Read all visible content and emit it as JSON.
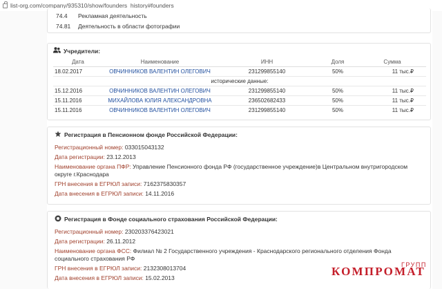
{
  "browser": {
    "url": "list-org.com/company/935310/show/founders_history#founders"
  },
  "okved": [
    {
      "code": "74.4",
      "name": "Рекламная деятельность"
    },
    {
      "code": "74.81",
      "name": "Деятельность в области фотографии"
    }
  ],
  "founders": {
    "title": "Учредители:",
    "columns": [
      "Дата",
      "Наименование",
      "ИНН",
      "Доля",
      "Сумма"
    ],
    "current": {
      "date": "18.02.2017",
      "name": "ОВЧИННИКОВ ВАЛЕНТИН ОЛЕГОВИЧ",
      "inn": "231299855140",
      "share": "50%",
      "sum": "11 тыс.₽"
    },
    "history_label": "исторические данные:",
    "history": [
      {
        "date": "15.12.2016",
        "name": "ОВЧИННИКОВ ВАЛЕНТИН ОЛЕГОВИЧ",
        "inn": "231299855140",
        "share": "50%",
        "sum": "11 тыс.₽"
      },
      {
        "date": "15.11.2016",
        "name": "МИХАЙЛОВА ЮЛИЯ АЛЕКСАНДРОВНА",
        "inn": "236502682433",
        "share": "50%",
        "sum": "11 тыс.₽"
      },
      {
        "date": "15.11.2016",
        "name": "ОВЧИННИКОВ ВАЛЕНТИН ОЛЕГОВИЧ",
        "inn": "231299855140",
        "share": "50%",
        "sum": "11 тыс.₽"
      }
    ]
  },
  "pfr": {
    "title": "Регистрация в Пенсионном фонде Российской Федерации:",
    "rows": [
      {
        "key": "Регистрационный номер:",
        "value": "033015043132"
      },
      {
        "key": "Дата регистрации:",
        "value": "23.12.2013"
      },
      {
        "key": "Наименование органа ПФР:",
        "value": "Управление Пенсионного фонда РФ (государственное учреждение)в Центральном внутригородском округе г.Краснодара"
      },
      {
        "key": "ГРН внесения в ЕГРЮЛ записи:",
        "value": "7162375830357"
      },
      {
        "key": "Дата внесения в ЕГРЮЛ записи:",
        "value": "14.11.2016"
      }
    ]
  },
  "fss": {
    "title": "Регистрация в Фонде социального страхования Российской Федерации:",
    "rows": [
      {
        "key": "Регистрационный номер:",
        "value": "230203376423021"
      },
      {
        "key": "Дата регистрации:",
        "value": "26.11.2012"
      },
      {
        "key": "Наименование органа ФСС:",
        "value": "Филиал № 2 Государственного учреждения - Краснодарского регионального отделения Фонда социального страхования РФ"
      },
      {
        "key": "ГРН внесения в ЕГРЮЛ записи:",
        "value": "2132308013704"
      },
      {
        "key": "Дата внесения в ЕГРЮЛ записи:",
        "value": "15.02.2013"
      }
    ]
  },
  "watermark": {
    "main": "КОМПРОМАТ",
    "small": "ГРУПП"
  }
}
